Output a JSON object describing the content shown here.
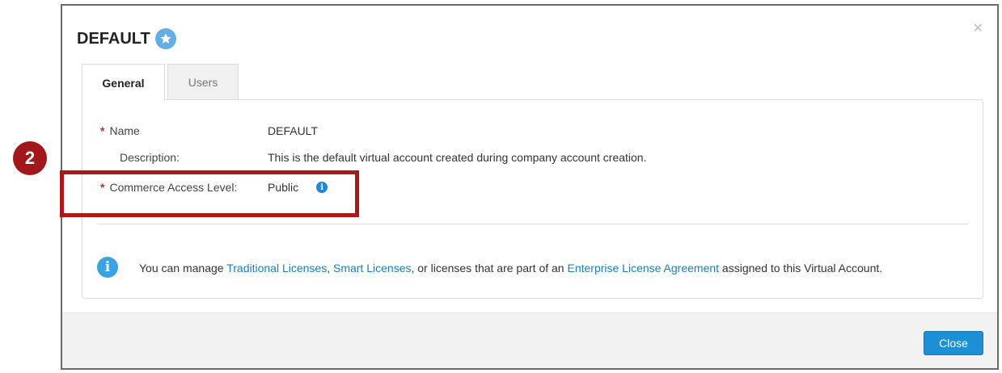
{
  "dialog": {
    "title": "DEFAULT",
    "close_glyph": "×",
    "title_icon": "star-icon"
  },
  "tabs": [
    {
      "label": "General",
      "active": true
    },
    {
      "label": "Users",
      "active": false
    }
  ],
  "fields": {
    "name": {
      "required_marker": "*",
      "label": "Name",
      "value": "DEFAULT"
    },
    "description": {
      "label": "Description:",
      "value": "This is the default virtual account created during company account creation."
    },
    "access_level": {
      "required_marker": "*",
      "label": "Commerce Access Level:",
      "value": "Public",
      "info_icon": "info-icon"
    }
  },
  "notice": {
    "prefix": "You can manage ",
    "link1": "Traditional Licenses",
    "sep1": ", ",
    "link2": "Smart Licenses",
    "middle": ", or licenses that are part of an ",
    "link3": "Enterprise License Agreement",
    "suffix": " assigned to this Virtual Account."
  },
  "footer": {
    "close_label": "Close"
  },
  "annotation": {
    "step_number": "2"
  },
  "colors": {
    "accent": "#1d8fd4",
    "required": "#d9231d",
    "annotation": "#a21719",
    "link": "#1a7fc1"
  }
}
